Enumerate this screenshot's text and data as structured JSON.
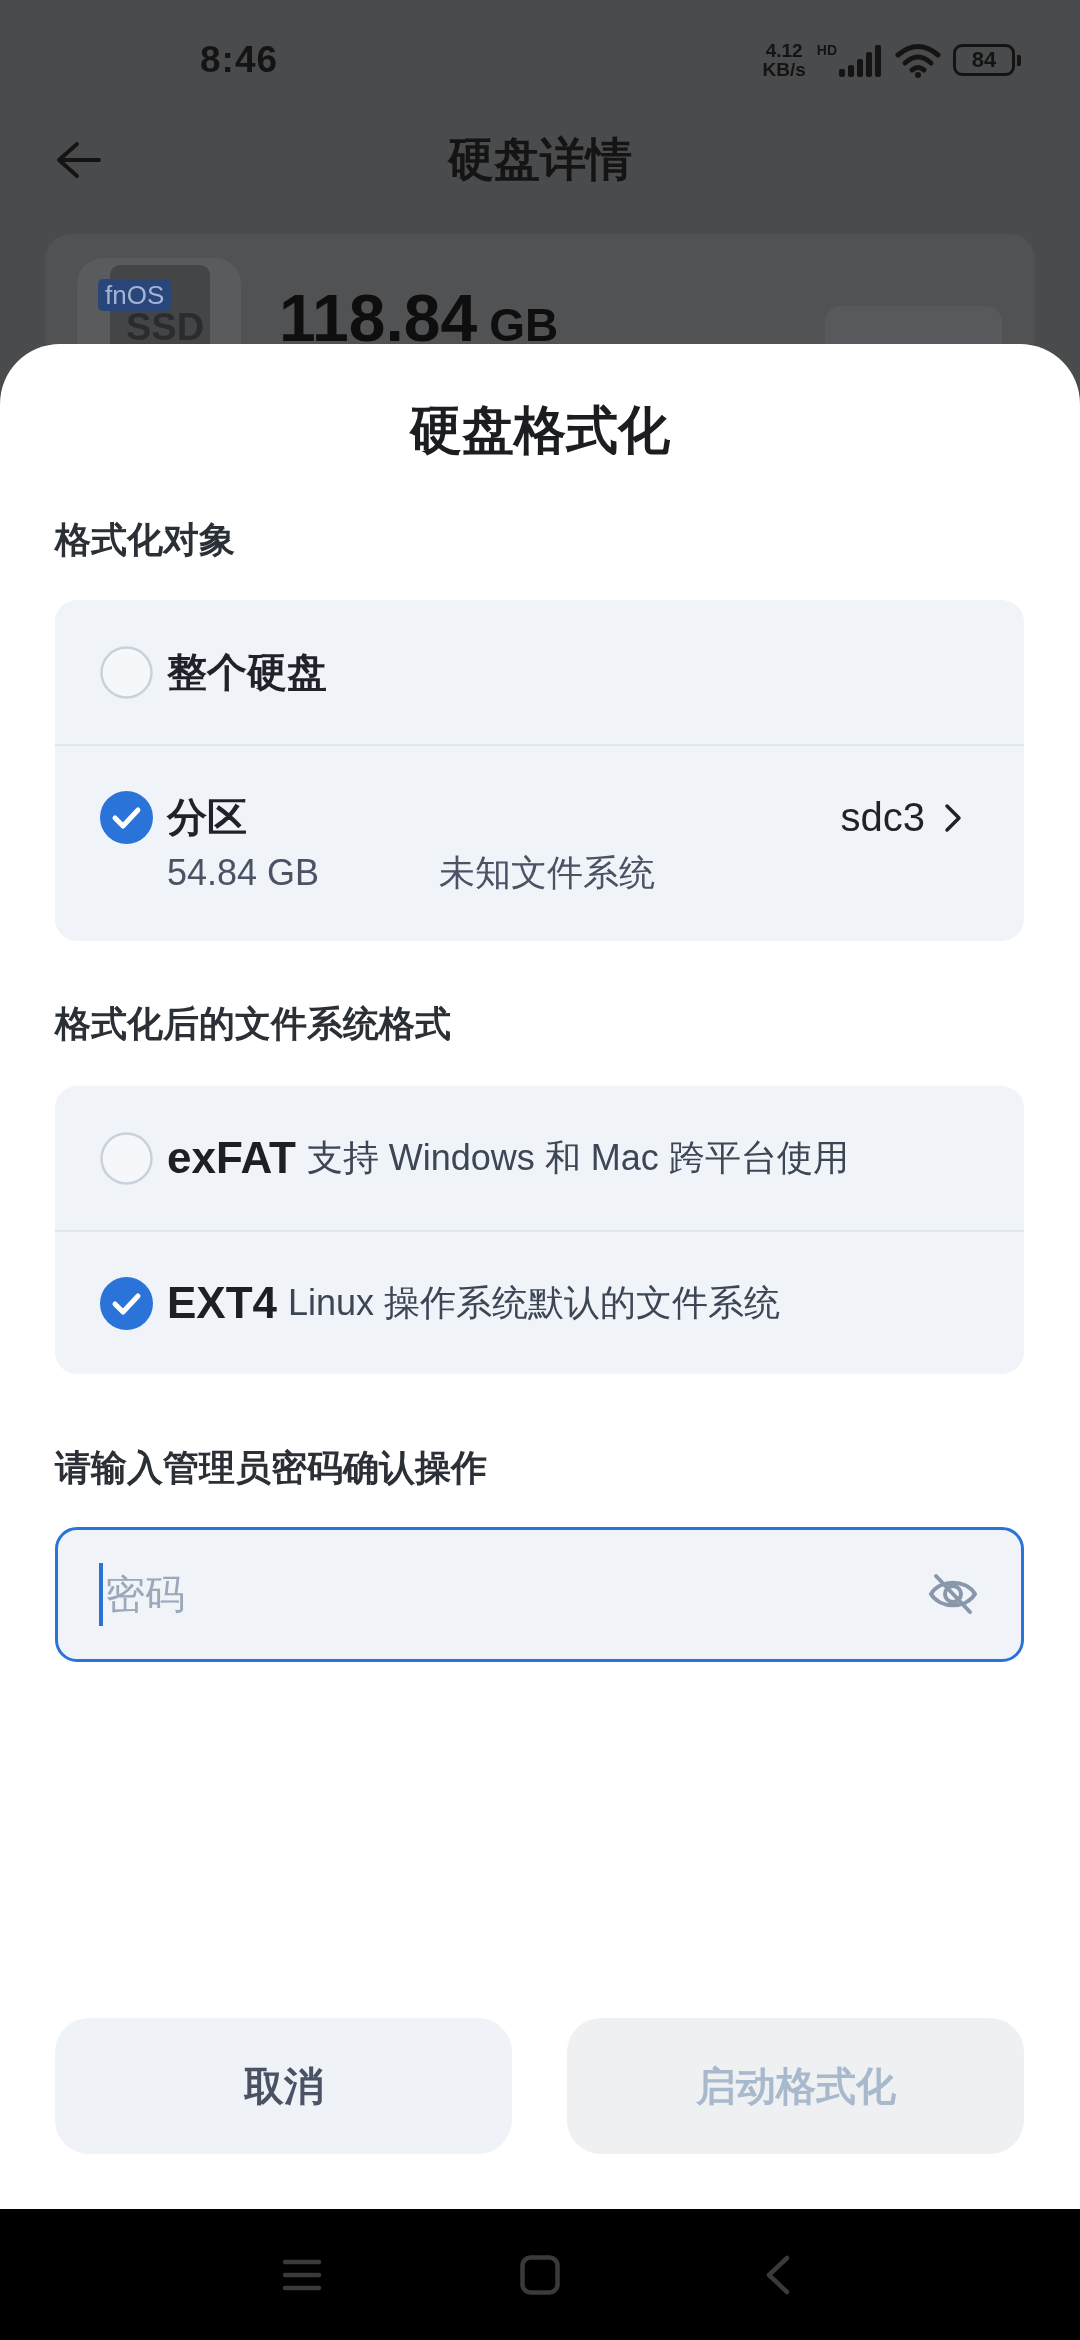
{
  "status_bar": {
    "time": "8:46",
    "network_speed": "4.12",
    "network_speed_unit": "KB/s",
    "network_type": "HD",
    "battery": "84"
  },
  "header": {
    "title": "硬盘详情"
  },
  "disk_card": {
    "logo": "fnOS",
    "drive_type": "SSD",
    "capacity": "118.84",
    "unit": "GB"
  },
  "sheet": {
    "title": "硬盘格式化",
    "target_section": {
      "label": "格式化对象",
      "options": [
        {
          "kind": "whole",
          "label": "整个硬盘",
          "selected": false
        },
        {
          "kind": "partition",
          "label": "分区",
          "partition": "sdc3",
          "size": "54.84 GB",
          "filesystem": "未知文件系统",
          "selected": true
        }
      ]
    },
    "format_section": {
      "label": "格式化后的文件系统格式",
      "options": [
        {
          "name": "exFAT",
          "description": "支持 Windows 和 Mac 跨平台使用",
          "selected": false
        },
        {
          "name": "EXT4",
          "description": "Linux 操作系统默认的文件系统",
          "selected": true
        }
      ]
    },
    "password": {
      "label": "请输入管理员密码确认操作",
      "placeholder": "密码",
      "focused": true
    },
    "buttons": [
      {
        "label": "取消",
        "disabled": false
      },
      {
        "label": "启动格式化",
        "disabled": true
      }
    ]
  }
}
